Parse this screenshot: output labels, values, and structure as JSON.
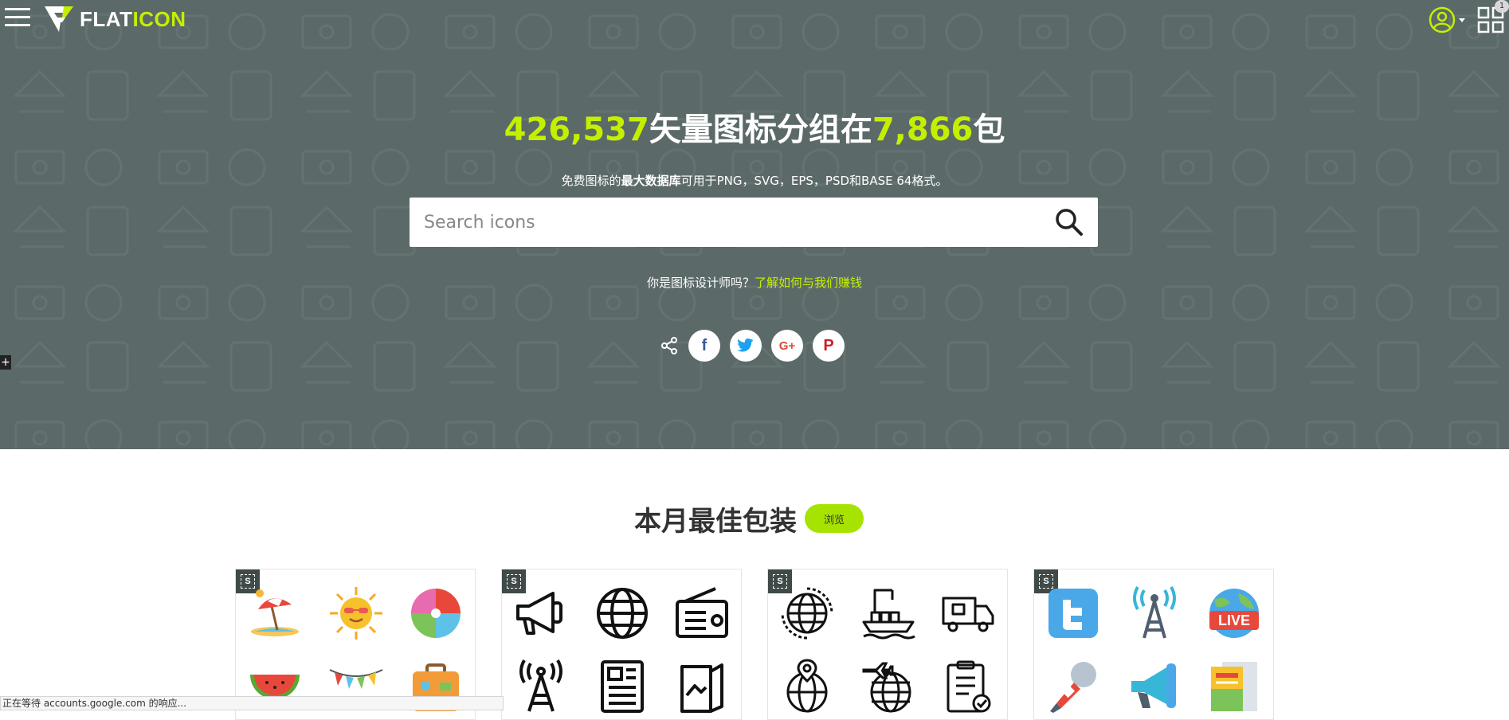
{
  "brand": {
    "name_part1": "FLAT",
    "name_part2": "ICON",
    "accent_color": "#c4f000",
    "hero_color": "#5b6a69"
  },
  "header": {
    "menu_icon": "hamburger-menu-icon",
    "user_icon": "user-account-icon",
    "apps_icon": "apps-grid-icon",
    "notification_count": "1"
  },
  "hero": {
    "icon_count": "426,537",
    "headline_middle": "矢量图标分组在",
    "pack_count": "7,866",
    "headline_end": "包",
    "subtitle_pre": "免费图标的",
    "subtitle_bold": "最大数据库",
    "subtitle_post": "可用于PNG，SVG，EPS，PSD和BASE 64格式。",
    "search_placeholder": "Search icons",
    "designer_question": "你是图标设计师吗？",
    "designer_link": "了解如何与我们赚钱"
  },
  "share": {
    "share_icon": "share-icon",
    "networks": [
      {
        "name": "facebook",
        "glyph": "f"
      },
      {
        "name": "twitter",
        "glyph": "twitter-bird"
      },
      {
        "name": "google-plus",
        "glyph": "G+"
      },
      {
        "name": "pinterest",
        "glyph": "P"
      }
    ]
  },
  "side_toggle": "+",
  "best_packs": {
    "title": "本月最佳包装",
    "browse_label": "浏览",
    "packs": [
      {
        "badge": "S",
        "icons": [
          "beach-umbrella-icon",
          "smiling-sun-icon",
          "beach-ball-icon",
          "watermelon-icon",
          "bunting-flags-icon",
          "suitcase-icon"
        ]
      },
      {
        "badge": "S",
        "icons": [
          "megaphone-icon",
          "globe-icon",
          "radio-icon",
          "broadcast-tower-icon",
          "newspaper-icon",
          "magazine-icon"
        ]
      },
      {
        "badge": "S",
        "icons": [
          "global-network-icon",
          "cargo-ship-icon",
          "delivery-truck-icon",
          "location-globe-icon",
          "flight-globe-icon",
          "clipboard-check-icon"
        ]
      },
      {
        "badge": "S",
        "icons": [
          "twitter-logo-icon",
          "antenna-tower-icon",
          "live-globe-icon",
          "microphone-icon",
          "loudspeaker-icon",
          "news-paper-icon"
        ]
      }
    ]
  },
  "status_bar": {
    "text": "正在等待 accounts.google.com 的响应..."
  }
}
